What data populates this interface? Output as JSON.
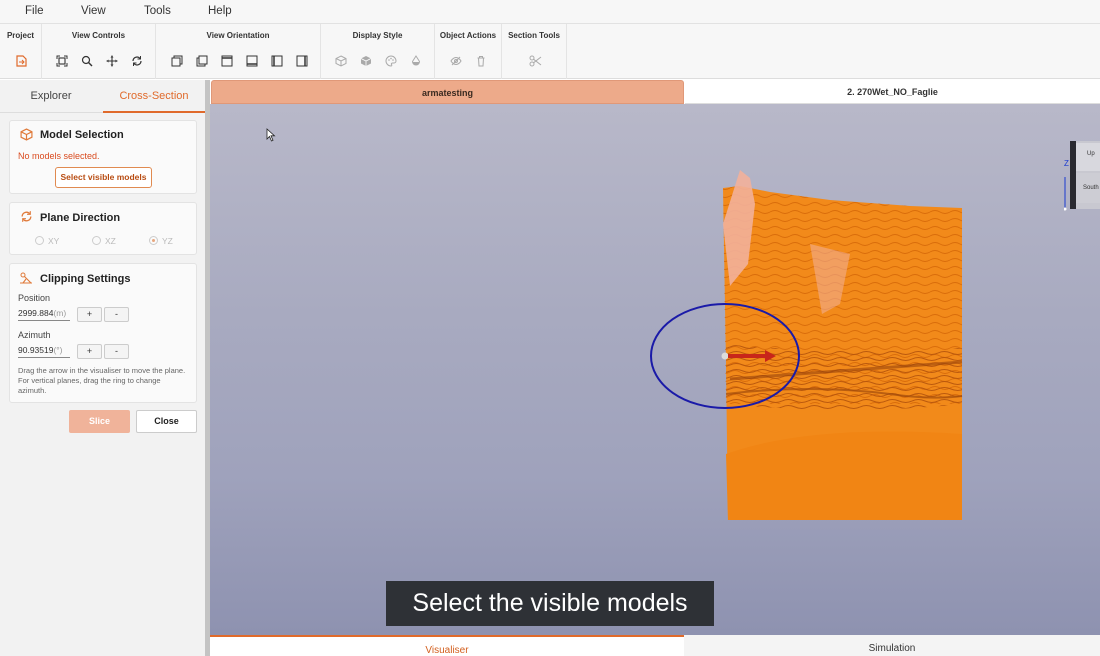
{
  "menu": [
    "File",
    "View",
    "Tools",
    "Help"
  ],
  "toolbar": {
    "groups": {
      "project": "Project",
      "view_controls": "View Controls",
      "view_orientation": "View Orientation",
      "display_style": "Display Style",
      "object_actions": "Object Actions",
      "section_tools": "Section Tools"
    }
  },
  "left_tabs": {
    "explorer": "Explorer",
    "cross_section": "Cross-Section"
  },
  "model_selection": {
    "title": "Model Selection",
    "warning": "No models selected.",
    "button": "Select visible models"
  },
  "plane_direction": {
    "title": "Plane Direction",
    "options": [
      "XY",
      "XZ",
      "YZ"
    ],
    "selected": "YZ"
  },
  "clipping": {
    "title": "Clipping Settings",
    "position_label": "Position",
    "position_value": "2999.884",
    "position_unit": "(m)",
    "azimuth_label": "Azimuth",
    "azimuth_value": "90.93519",
    "azimuth_unit": "(°)",
    "plus": "+",
    "minus": "-",
    "help": "Drag the arrow in the visualiser to move the plane. For vertical planes, drag the ring to change azimuth."
  },
  "actions": {
    "slice": "Slice",
    "close": "Close"
  },
  "doc_tabs": {
    "active": "armatesting",
    "second": "2. 270Wet_NO_Faglie"
  },
  "bottom_tabs": {
    "visualiser": "Visualiser",
    "simulation": "Simulation"
  },
  "caption": "Select the visible models",
  "navcube": {
    "top": "Up",
    "bottom": "South",
    "axis": "Z"
  },
  "colors": {
    "accent": "#e06a2b",
    "model": "#f0861a",
    "ring": "#1a1aa8",
    "arrow": "#c8261a"
  }
}
